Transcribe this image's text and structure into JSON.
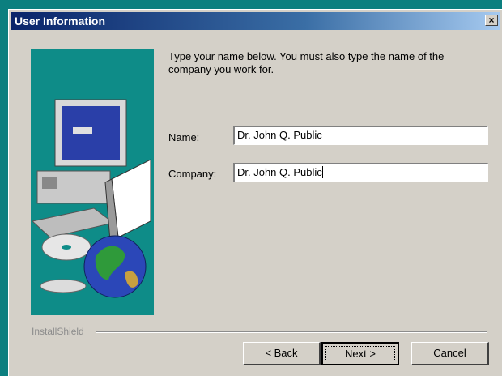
{
  "window": {
    "title": "User Information",
    "close_glyph": "×"
  },
  "prompt": "Type your name below. You must also type the name of the company you work for.",
  "form": {
    "name_label": "Name:",
    "name_value": "Dr. John Q. Public",
    "company_label": "Company:",
    "company_value": "Dr. John Q. Public"
  },
  "footer": {
    "brand": "InstallShield"
  },
  "buttons": {
    "back": "< Back",
    "next": "Next >",
    "cancel": "Cancel"
  },
  "colors": {
    "desktop": "#0b7f7f",
    "dialog": "#d4d0c8",
    "art_bg": "#0e8c88",
    "title_start": "#0a246a",
    "title_end": "#a6caf0"
  },
  "icons": {
    "art": "computer-globe-cd-illustration",
    "close": "close-icon"
  }
}
